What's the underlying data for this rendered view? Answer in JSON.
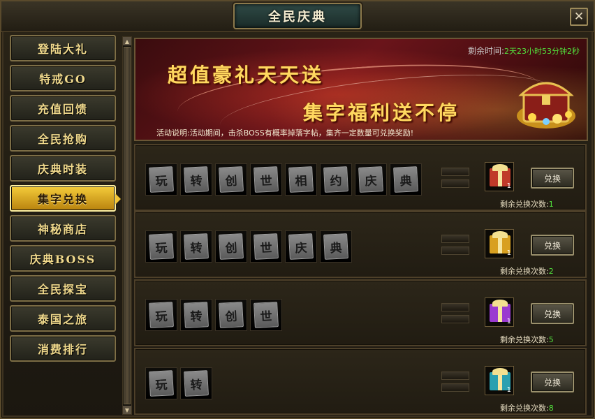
{
  "window": {
    "title": "全民庆典",
    "close_label": "✕"
  },
  "sidebar": {
    "items": [
      {
        "label": "登陆大礼"
      },
      {
        "label": "特戒GO"
      },
      {
        "label": "充值回馈"
      },
      {
        "label": "全民抢购"
      },
      {
        "label": "庆典时装"
      },
      {
        "label": "集字兑换",
        "active": true
      },
      {
        "label": "神秘商店"
      },
      {
        "label": "庆典BOSS"
      },
      {
        "label": "全民探宝"
      },
      {
        "label": "泰国之旅"
      },
      {
        "label": "消费排行"
      }
    ]
  },
  "banner": {
    "remain_label": "剩余时间:",
    "remain_value": "2天23小时53分钟2秒",
    "slogan1": "超值豪礼天天送",
    "slogan2": "集字福利送不停",
    "activity_label": "活动说明:",
    "activity_text": "活动期间，击杀BOSS有概率掉落字帖，集齐一定数量可兑换奖励!"
  },
  "rows": [
    {
      "tiles": [
        "玩",
        "转",
        "创",
        "世",
        "相",
        "约",
        "庆",
        "典"
      ],
      "reward_count": "1",
      "reward_color": "#c03a2a",
      "button": "兑换",
      "remain_label": "剩余兑换次数:",
      "remain_value": "1"
    },
    {
      "tiles": [
        "玩",
        "转",
        "创",
        "世",
        "庆",
        "典"
      ],
      "reward_count": "1",
      "reward_color": "#d8a020",
      "button": "兑换",
      "remain_label": "剩余兑换次数:",
      "remain_value": "2"
    },
    {
      "tiles": [
        "玩",
        "转",
        "创",
        "世"
      ],
      "reward_count": "1",
      "reward_color": "#9a3ad0",
      "button": "兑换",
      "remain_label": "剩余兑换次数:",
      "remain_value": "5"
    },
    {
      "tiles": [
        "玩",
        "转"
      ],
      "reward_count": "1",
      "reward_color": "#2aa0b0",
      "button": "兑换",
      "remain_label": "剩余兑换次数:",
      "remain_value": "8"
    }
  ]
}
